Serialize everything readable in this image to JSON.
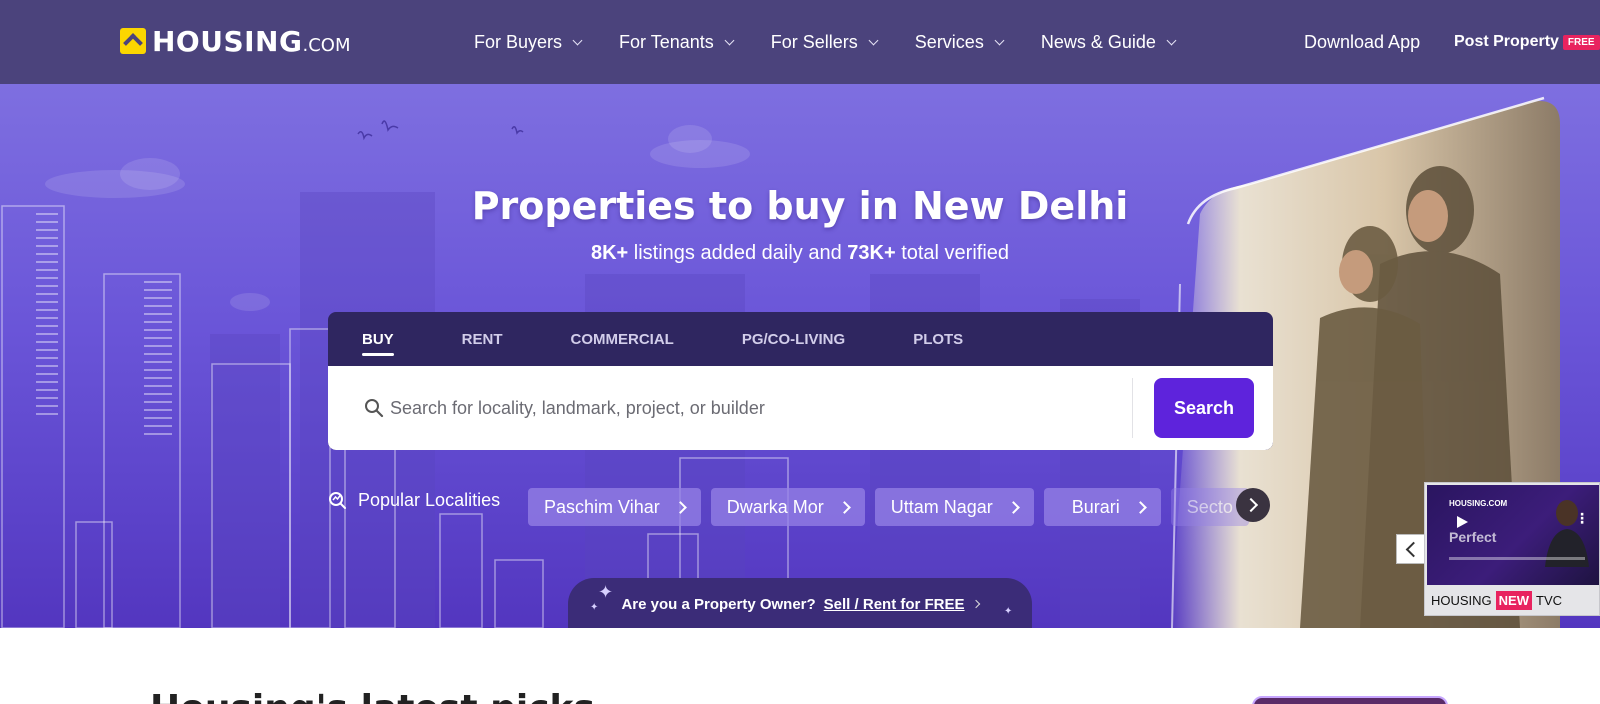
{
  "header": {
    "logo_text": "HOUSING",
    "logo_suffix": ".COM",
    "nav": [
      {
        "label": "For Buyers"
      },
      {
        "label": "For Tenants"
      },
      {
        "label": "For Sellers"
      },
      {
        "label": "Services"
      },
      {
        "label": "News & Guide"
      }
    ],
    "download_app": "Download App",
    "post_property": "Post Property",
    "free_badge": "FREE"
  },
  "hero": {
    "title": "Properties to buy in New Delhi",
    "subtitle_count1": "8K+",
    "subtitle_mid": " listings added daily and ",
    "subtitle_count2": "73K+",
    "subtitle_end": " total verified",
    "tabs": [
      {
        "label": "BUY",
        "active": true
      },
      {
        "label": "RENT"
      },
      {
        "label": "COMMERCIAL"
      },
      {
        "label": "PG/CO-LIVING"
      },
      {
        "label": "PLOTS"
      }
    ],
    "search": {
      "placeholder": "Search for locality, landmark, project, or builder",
      "button": "Search"
    },
    "popular_label": "Popular Localities",
    "localities": [
      "Paschim Vihar",
      "Dwarka Mor",
      "Uttam Nagar",
      "Burari",
      "Secto"
    ],
    "owner_question": "Are you a Property Owner?",
    "owner_link": "Sell / Rent for FREE"
  },
  "tvc": {
    "brand": "HOUSING",
    "badge": "NEW",
    "suffix": "TVC",
    "video_brand": "HOUSING.COM",
    "video_text": "Perfect"
  },
  "section": {
    "title": "Housing's latest picks"
  },
  "colors": {
    "header_bg": "#4b437c",
    "accent": "#5e23dc",
    "free_badge": "#e8235f",
    "logo_yellow": "#fbd600"
  }
}
